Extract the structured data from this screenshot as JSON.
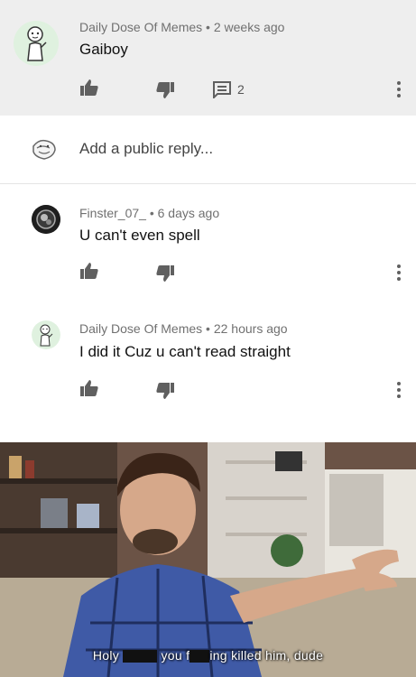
{
  "comments": [
    {
      "author": "Daily Dose Of Memes",
      "time": "2 weeks ago",
      "text": "Gaiboy",
      "reply_count": "2"
    },
    {
      "author": "Finster_07_",
      "time": "6 days ago",
      "text": "U can't even spell"
    },
    {
      "author": "Daily Dose Of Memes",
      "time": "22 hours ago",
      "text": "I did it Cuz u can't read straight"
    }
  ],
  "meta_separator": " • ",
  "reply_input": {
    "placeholder": "Add a public reply..."
  },
  "meme": {
    "caption_part1": "Holy",
    "caption_part2": "you f",
    "caption_part3": "ing killed him, dude"
  },
  "colors": {
    "highlight_bg": "#eeeeee",
    "icon_gray": "#606060",
    "meta_gray": "#707070"
  }
}
